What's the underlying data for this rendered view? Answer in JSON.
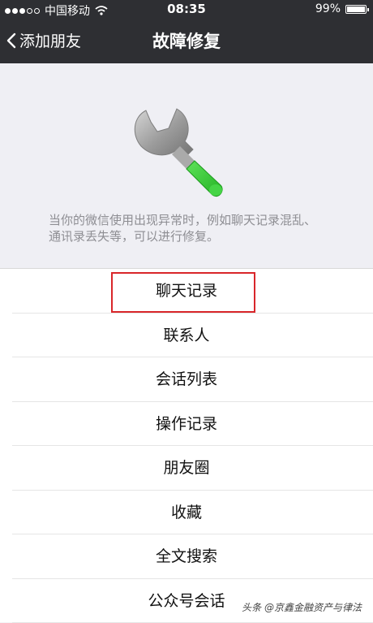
{
  "status_bar": {
    "carrier": "中国移动",
    "time": "08:35",
    "battery": "99%",
    "battery_level": 0.99,
    "signal_bars_filled": 3,
    "signal_bars_total": 5
  },
  "nav": {
    "back_label": "添加朋友",
    "title": "故障修复"
  },
  "hero": {
    "icon": "wrench-icon",
    "description": "当你的微信使用出现异常时，例如聊天记录混乱、通讯录丢失等，可以进行修复。"
  },
  "repair_items": [
    {
      "label": "聊天记录"
    },
    {
      "label": "联系人"
    },
    {
      "label": "会话列表"
    },
    {
      "label": "操作记录"
    },
    {
      "label": "朋友圈"
    },
    {
      "label": "收藏"
    },
    {
      "label": "全文搜索"
    },
    {
      "label": "公众号会话"
    }
  ],
  "watermark": "头条 @京鑫金融资产与律法",
  "colors": {
    "nav_background": "#2e2f33",
    "accent_green": "#3ecf3e",
    "highlight_red": "#d9262a"
  }
}
